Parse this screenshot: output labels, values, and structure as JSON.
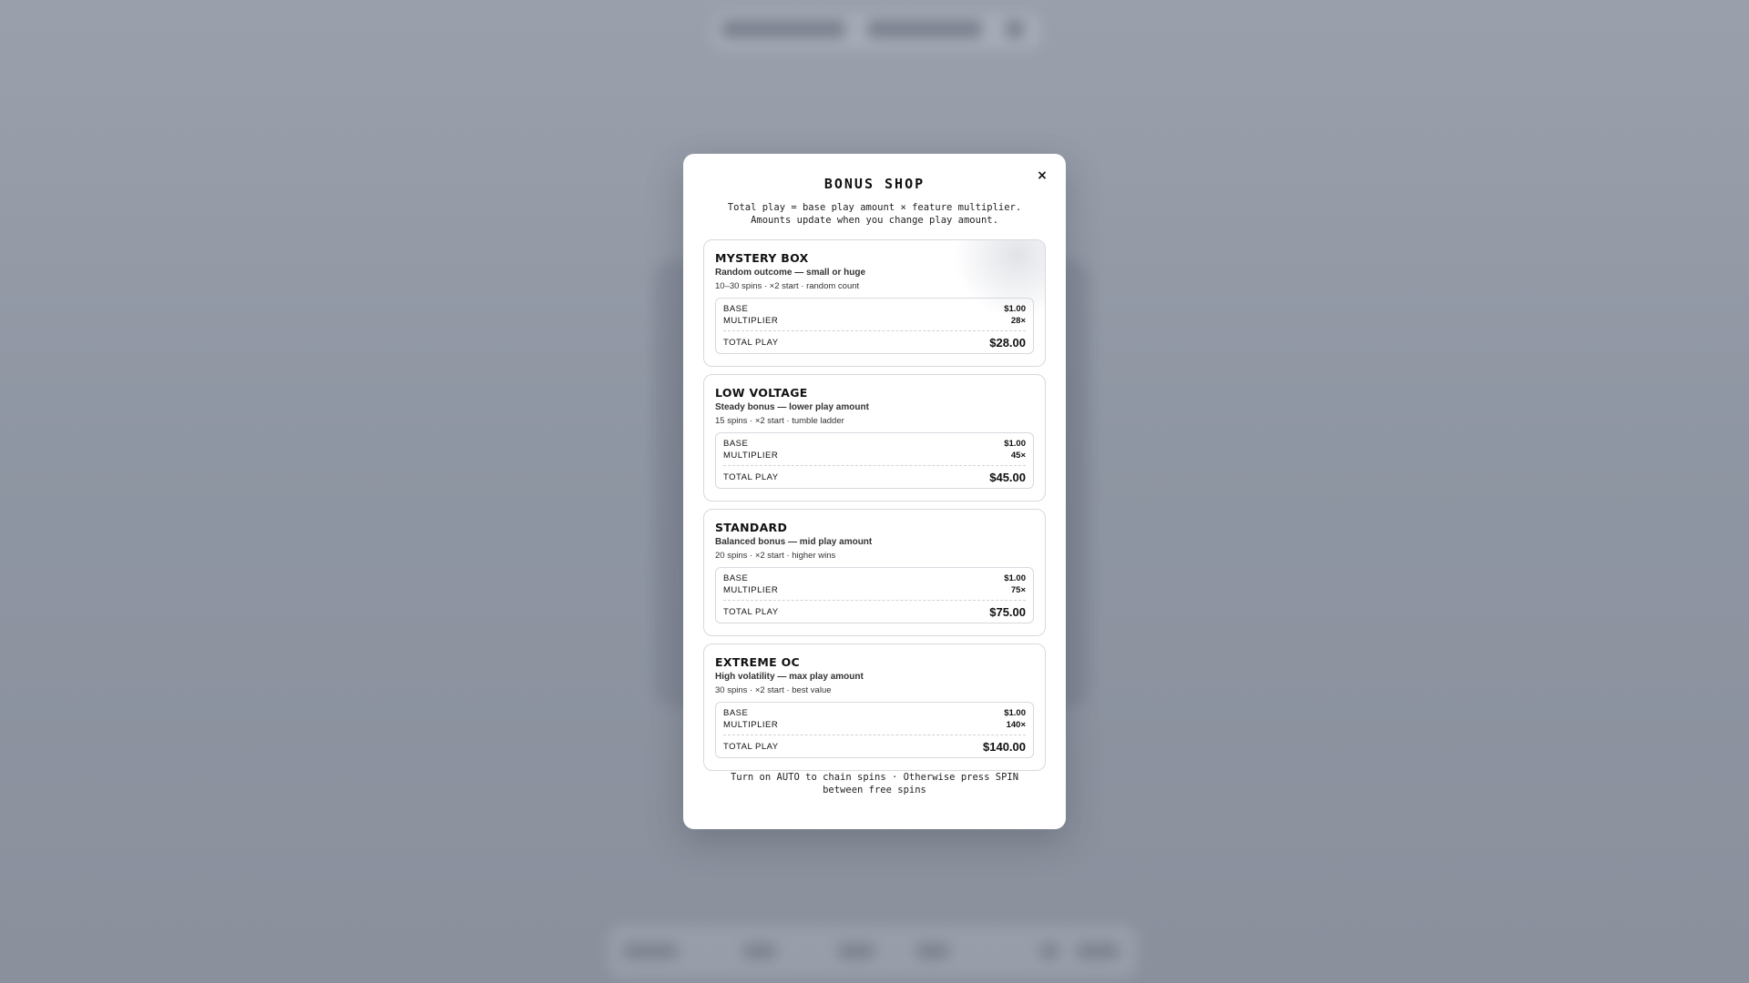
{
  "modal": {
    "title": "BONUS SHOP",
    "close_label": "×",
    "subtitle_line1": "Total play = base play amount × feature multiplier.",
    "subtitle_line2": "Amounts update when you change play amount.",
    "footer_line1": "Turn on AUTO to chain spins · Otherwise press SPIN",
    "footer_line2": "between free spins"
  },
  "labels": {
    "base": "BASE",
    "multiplier": "MULTIPLIER",
    "total_play": "TOTAL PLAY"
  },
  "bonuses": [
    {
      "name": "MYSTERY BOX",
      "description": "Random outcome — small or huge",
      "meta": "10–30 spins · ×2 start · random count",
      "base": "$1.00",
      "multiplier": "28×",
      "total": "$28.00"
    },
    {
      "name": "LOW VOLTAGE",
      "description": "Steady bonus — lower play amount",
      "meta": "15 spins · ×2 start · tumble ladder",
      "base": "$1.00",
      "multiplier": "45×",
      "total": "$45.00"
    },
    {
      "name": "STANDARD",
      "description": "Balanced bonus — mid play amount",
      "meta": "20 spins · ×2 start · higher wins",
      "base": "$1.00",
      "multiplier": "75×",
      "total": "$75.00"
    },
    {
      "name": "EXTREME OC",
      "description": "High volatility — max play amount",
      "meta": "30 spins · ×2 start · best value",
      "base": "$1.00",
      "multiplier": "140×",
      "total": "$140.00"
    }
  ]
}
